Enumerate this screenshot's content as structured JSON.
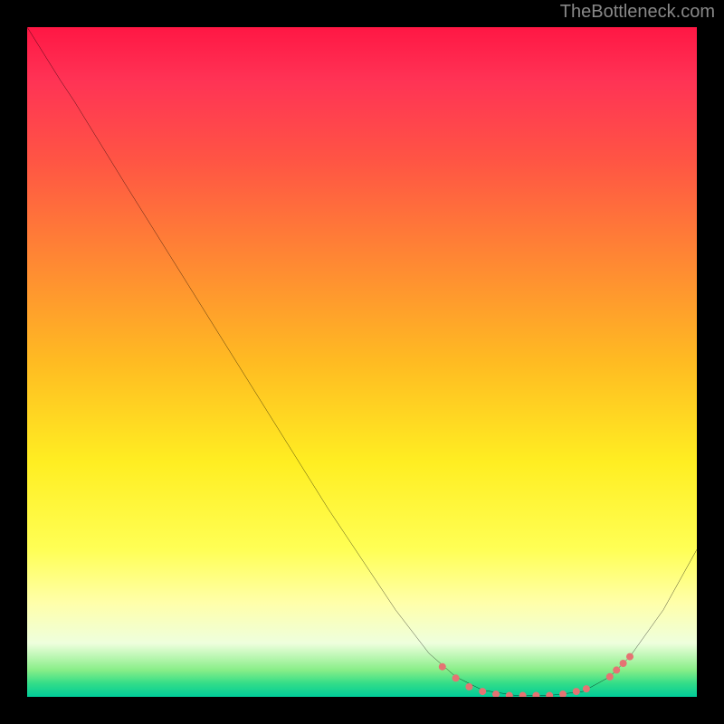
{
  "attribution": "TheBottleneck.com",
  "chart_data": {
    "type": "line",
    "title": "",
    "xlabel": "",
    "ylabel": "",
    "xlim": [
      0,
      100
    ],
    "ylim": [
      0,
      100
    ],
    "background_gradient": {
      "direction": "vertical",
      "stops": [
        {
          "pos": 0.0,
          "color": "#ff1744"
        },
        {
          "pos": 0.5,
          "color": "#ffee22"
        },
        {
          "pos": 0.92,
          "color": "#eeffdd"
        },
        {
          "pos": 1.0,
          "color": "#00cc99"
        }
      ]
    },
    "series": [
      {
        "name": "curve",
        "stroke": "#000000",
        "points": [
          {
            "x": 0.0,
            "y": 100.0
          },
          {
            "x": 5.0,
            "y": 92.0
          },
          {
            "x": 7.0,
            "y": 89.0
          },
          {
            "x": 15.0,
            "y": 76.0
          },
          {
            "x": 25.0,
            "y": 60.0
          },
          {
            "x": 35.0,
            "y": 44.0
          },
          {
            "x": 45.0,
            "y": 28.0
          },
          {
            "x": 55.0,
            "y": 13.0
          },
          {
            "x": 60.0,
            "y": 6.5
          },
          {
            "x": 64.0,
            "y": 3.0
          },
          {
            "x": 68.0,
            "y": 1.0
          },
          {
            "x": 73.0,
            "y": 0.2
          },
          {
            "x": 78.0,
            "y": 0.2
          },
          {
            "x": 83.0,
            "y": 0.8
          },
          {
            "x": 87.0,
            "y": 3.0
          },
          {
            "x": 90.0,
            "y": 6.0
          },
          {
            "x": 95.0,
            "y": 13.0
          },
          {
            "x": 100.0,
            "y": 22.0
          }
        ]
      }
    ],
    "markers": [
      {
        "x": 62.0,
        "y": 4.5
      },
      {
        "x": 64.0,
        "y": 2.8
      },
      {
        "x": 66.0,
        "y": 1.5
      },
      {
        "x": 68.0,
        "y": 0.8
      },
      {
        "x": 70.0,
        "y": 0.4
      },
      {
        "x": 72.0,
        "y": 0.2
      },
      {
        "x": 74.0,
        "y": 0.2
      },
      {
        "x": 76.0,
        "y": 0.2
      },
      {
        "x": 78.0,
        "y": 0.2
      },
      {
        "x": 80.0,
        "y": 0.4
      },
      {
        "x": 82.0,
        "y": 0.8
      },
      {
        "x": 83.5,
        "y": 1.2
      },
      {
        "x": 87.0,
        "y": 3.0
      },
      {
        "x": 88.0,
        "y": 4.0
      },
      {
        "x": 89.0,
        "y": 5.0
      },
      {
        "x": 90.0,
        "y": 6.0
      }
    ],
    "marker_style": {
      "color": "#e57373",
      "radius": 4
    }
  }
}
